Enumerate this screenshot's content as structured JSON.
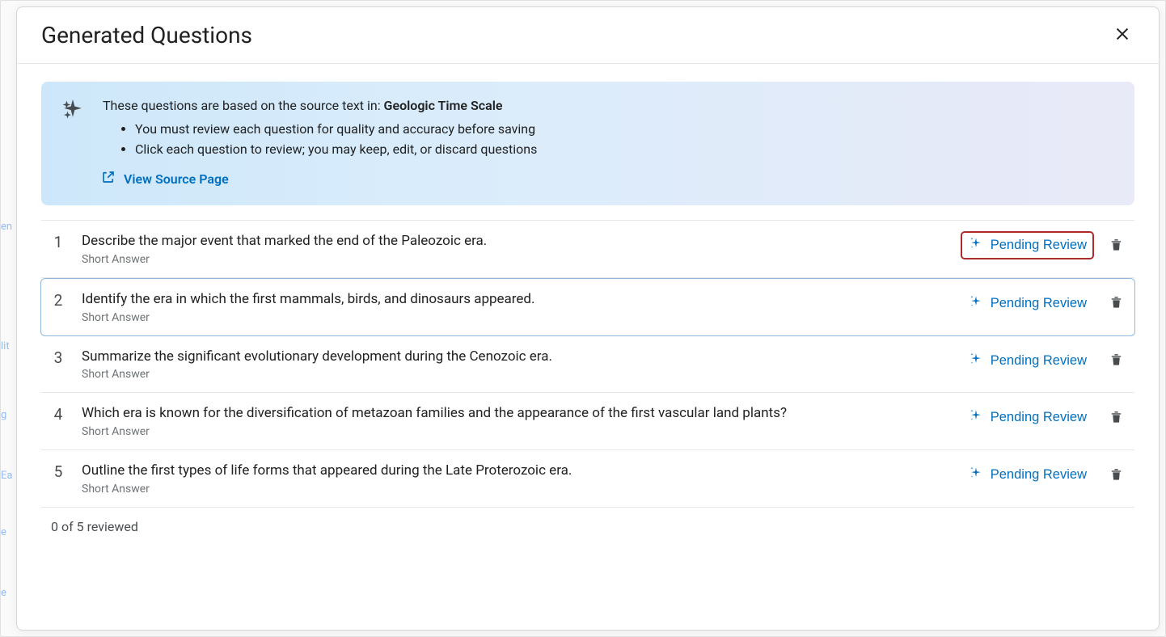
{
  "modal": {
    "title": "Generated Questions"
  },
  "banner": {
    "intro_prefix": "These questions are based on the source text in: ",
    "source_title": "Geologic Time Scale",
    "bullets": [
      "You must review each question for quality and accuracy before saving",
      "Click each question to review; you may keep, edit, or discard questions"
    ],
    "source_link_label": "View Source Page"
  },
  "questions": [
    {
      "num": "1",
      "text": "Describe the major event that marked the end of the Paleozoic era.",
      "type": "Short Answer",
      "status": "Pending Review",
      "selected": false,
      "status_highlight": true
    },
    {
      "num": "2",
      "text": "Identify the era in which the first mammals, birds, and dinosaurs appeared.",
      "type": "Short Answer",
      "status": "Pending Review",
      "selected": true,
      "status_highlight": false
    },
    {
      "num": "3",
      "text": "Summarize the significant evolutionary development during the Cenozoic era.",
      "type": "Short Answer",
      "status": "Pending Review",
      "selected": false,
      "status_highlight": false
    },
    {
      "num": "4",
      "text": "Which era is known for the diversification of metazoan families and the appearance of the first vascular land plants?",
      "type": "Short Answer",
      "status": "Pending Review",
      "selected": false,
      "status_highlight": false
    },
    {
      "num": "5",
      "text": "Outline the first types of life forms that appeared during the Late Proterozoic era.",
      "type": "Short Answer",
      "status": "Pending Review",
      "selected": false,
      "status_highlight": false
    }
  ],
  "footer": {
    "status": "0 of 5 reviewed"
  },
  "bg_hints": [
    "en",
    "lit",
    "g",
    "Ea",
    "e",
    "e"
  ]
}
